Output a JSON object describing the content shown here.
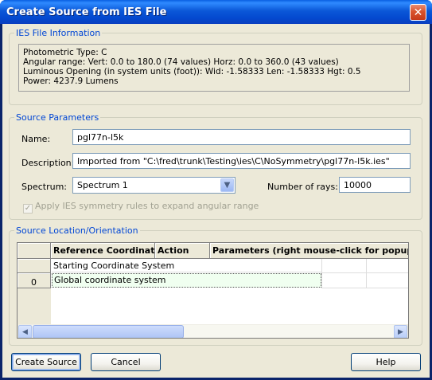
{
  "window": {
    "title": "Create Source from IES File",
    "close_glyph": "✕"
  },
  "ies_info": {
    "group_title": "IES File Information",
    "lines": [
      "Photometric Type: C",
      "Angular range:  Vert: 0.0 to 180.0 (74 values)  Horz: 0.0 to 360.0 (43 values)",
      "Luminous Opening (in system units (foot)):  Wid: -1.58333  Len: -1.58333  Hgt: 0.5",
      "Power: 4237.9 Lumens"
    ]
  },
  "source_params": {
    "group_title": "Source Parameters",
    "name_label": "Name:",
    "name_value": "pgl77n-l5k",
    "description_label": "Description:",
    "description_value": "Imported from \"C:\\fred\\trunk\\Testing\\ies\\C\\NoSymmetry\\pgl77n-l5k.ies\"",
    "spectrum_label": "Spectrum:",
    "spectrum_value": "Spectrum 1",
    "rays_label": "Number of rays:",
    "rays_value": "10000",
    "symmetry_label": "Apply IES symmetry rules to expand angular range",
    "symmetry_checked": true
  },
  "source_location": {
    "group_title": "Source Location/Orientation",
    "columns": [
      "Reference Coordinate",
      "Action",
      "Parameters (right mouse-click for popup me"
    ],
    "rows": [
      {
        "index": "",
        "reference": "Starting Coordinate System"
      },
      {
        "index": "0",
        "reference": "Global coordinate system"
      }
    ]
  },
  "buttons": {
    "create": "Create Source",
    "cancel": "Cancel",
    "help": "Help"
  },
  "icons": {
    "dropdown": "▼",
    "scroll_left": "◀",
    "scroll_right": "▶",
    "check": "✓"
  }
}
